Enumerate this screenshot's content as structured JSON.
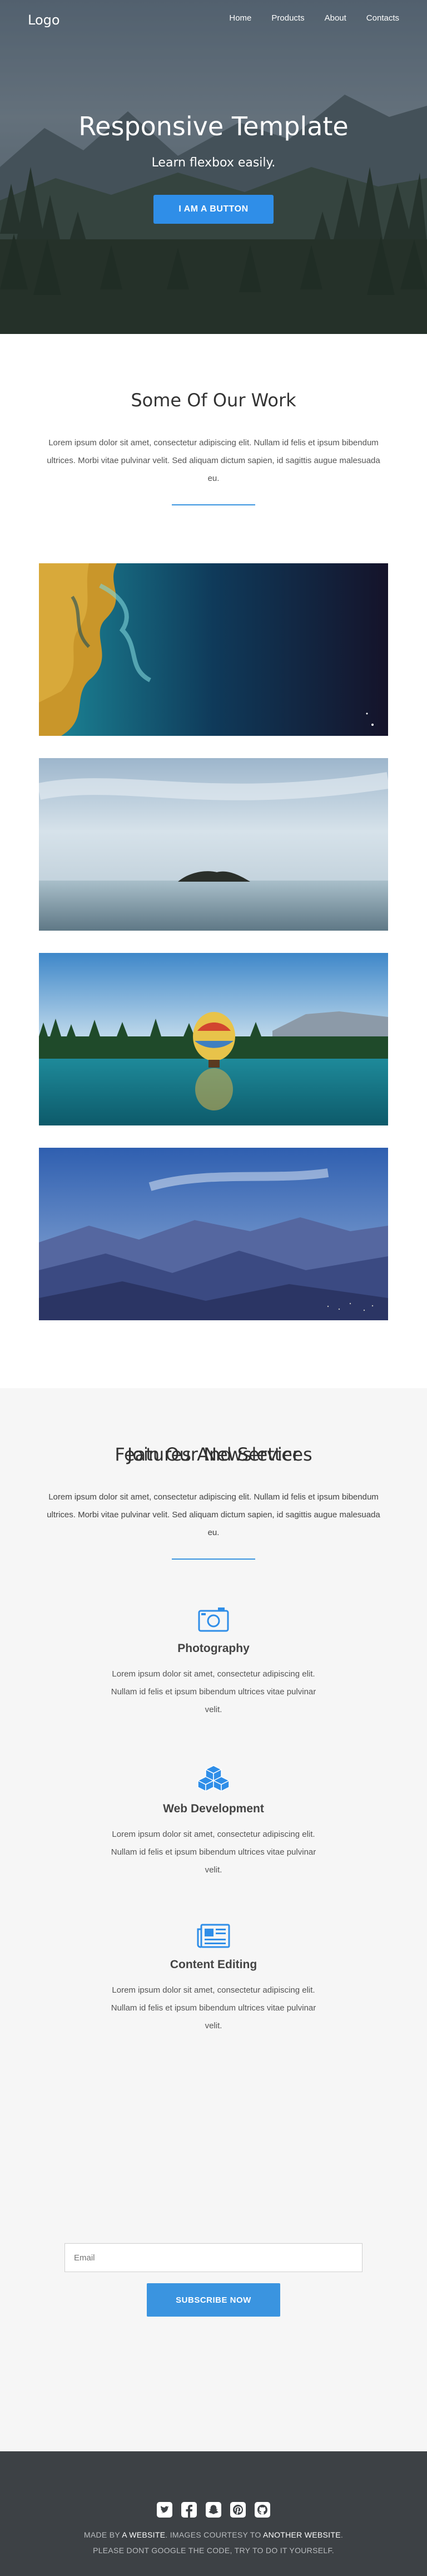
{
  "nav": {
    "logo": "Logo",
    "links": [
      "Home",
      "Products",
      "About",
      "Contacts"
    ]
  },
  "hero": {
    "title": "Responsive Template",
    "subtitle": "Learn flexbox easily.",
    "button": "I AM A BUTTON"
  },
  "work": {
    "title": "Some Of Our Work",
    "text": "Lorem ipsum dolor sit amet, consectetur adipiscing elit. Nullam id felis et ipsum bibendum ultrices. Morbi vitae pulvinar velit. Sed aliquam dictum sapien, id sagittis augue malesuada eu.",
    "images": [
      "satellite-coast-photo",
      "lone-island-photo",
      "hot-air-balloon-lake-photo",
      "blue-mountains-photo"
    ]
  },
  "features": {
    "title": "Features And Services",
    "text": "Lorem ipsum dolor sit amet, consectetur adipiscing elit. Nullam id felis et ipsum bibendum ultrices. Morbi vitae pulvinar velit. Sed aliquam dictum sapien, id sagittis augue malesuada eu.",
    "items": [
      {
        "icon": "camera-icon",
        "title": "Photography",
        "text": "Lorem ipsum dolor sit amet, consectetur adipiscing elit. Nullam id felis et ipsum bibendum ultrices vitae pulvinar velit."
      },
      {
        "icon": "cubes-icon",
        "title": "Web Development",
        "text": "Lorem ipsum dolor sit amet, consectetur adipiscing elit. Nullam id felis et ipsum bibendum ultrices vitae pulvinar velit."
      },
      {
        "icon": "newspaper-icon",
        "title": "Content Editing",
        "text": "Lorem ipsum dolor sit amet, consectetur adipiscing elit. Nullam id felis et ipsum bibendum ultrices vitae pulvinar velit."
      }
    ]
  },
  "newsletter": {
    "title": "Join Our Newsletter",
    "text": "Lorem ipsum dolor sit amet, consectetur adipiscing elit. Nullam id felis et ipsum bibendum ultrices. Morbi vitae pulvinar velit. Sed aliquam dictum sapien, id sagittis augue malesuada eu.",
    "email_placeholder": "Email",
    "button": "SUBSCRIBE NOW"
  },
  "footer": {
    "social_icons": [
      "twitter-icon",
      "facebook-icon",
      "snapchat-icon",
      "pinterest-icon",
      "github-icon"
    ],
    "line1_a": "MADE BY ",
    "line1_b": "A WEBSITE",
    "line1_c": ". IMAGES COURTESY TO ",
    "line1_d": "ANOTHER WEBSITE",
    "line1_e": ".",
    "line2": "PLEASE DONT GOOGLE THE CODE, TRY TO DO IT YOURSELF."
  },
  "colors": {
    "accent": "#3a94e0",
    "footer_bg": "#3d4145",
    "features_bg": "#f6f6f6"
  }
}
